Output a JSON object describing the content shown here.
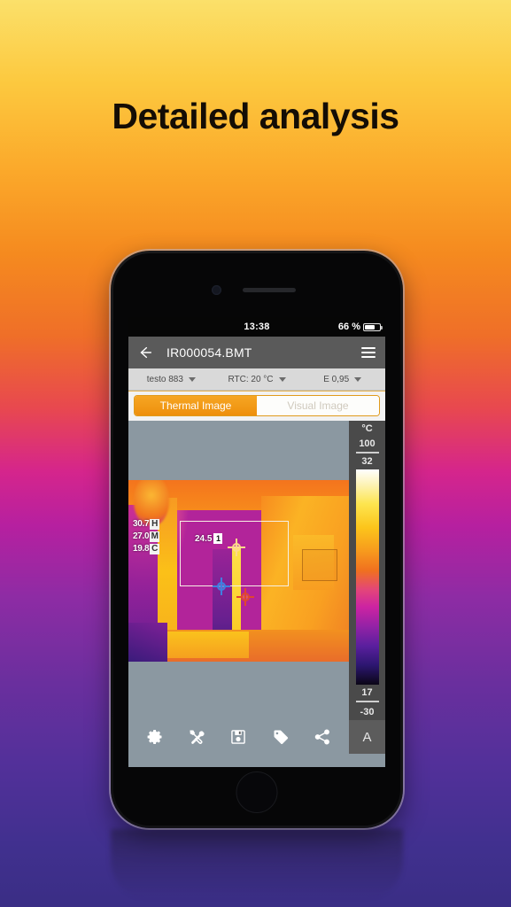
{
  "headline": "Detailed analysis",
  "statusbar": {
    "time": "13:38",
    "battery_percent": "66 %",
    "battery_icon": "battery-icon"
  },
  "app_header": {
    "back_icon": "back-arrow-icon",
    "title": "IR000054.BMT",
    "menu_icon": "hamburger-menu-icon"
  },
  "settings_row": [
    {
      "label": "testo 883",
      "icon": "chevron-down-icon"
    },
    {
      "label": "RTC: 20 °C",
      "icon": "chevron-down-icon"
    },
    {
      "label": "E 0,95",
      "icon": "chevron-down-icon"
    }
  ],
  "tabs": [
    {
      "label": "Thermal Image",
      "active": true
    },
    {
      "label": "Visual Image",
      "active": false
    }
  ],
  "image_overlay": {
    "stats": [
      {
        "value": "30.7",
        "key": "H"
      },
      {
        "value": "27.0",
        "key": "M"
      },
      {
        "value": "19.8",
        "key": "C"
      }
    ],
    "point_label": {
      "value": "24.5",
      "number": "1"
    },
    "markers": [
      {
        "name": "hot-spot-marker"
      },
      {
        "name": "cold-spot-marker"
      },
      {
        "name": "measurement-point-marker"
      }
    ],
    "measure_area": "measurement-rectangle"
  },
  "scale": {
    "unit": "°C",
    "max_range": "100",
    "max_span": "32",
    "min_span": "17",
    "min_range": "-30"
  },
  "toolbar": {
    "items": [
      {
        "name": "settings-icon",
        "label": "gear"
      },
      {
        "name": "tools-icon",
        "label": "tools"
      },
      {
        "name": "save-icon",
        "label": "save"
      },
      {
        "name": "tag-icon",
        "label": "tag"
      },
      {
        "name": "share-icon",
        "label": "share"
      }
    ],
    "auto_button": "A"
  },
  "colors": {
    "accent_orange": "#ee8f0c",
    "header_gray": "#5a5a5a",
    "screen_gray": "#8b98a1",
    "scale_gray": "#4a4a4a"
  }
}
